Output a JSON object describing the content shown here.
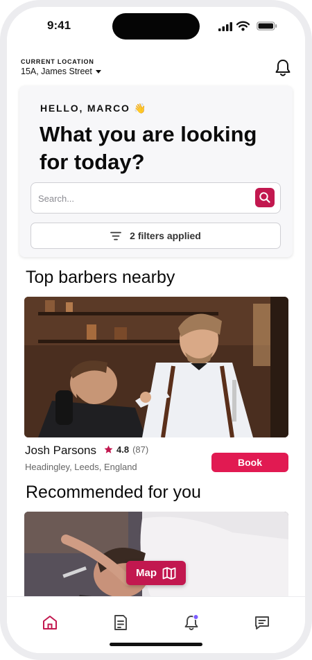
{
  "status_bar": {
    "time": "9:41"
  },
  "header": {
    "location_label": "CURRENT LOCATION",
    "location_value": "15A, James Street",
    "notification_icon": "bell-icon"
  },
  "hero": {
    "greeting": "HELLO, MARCO 👋",
    "title": "What you are looking for today?",
    "search": {
      "placeholder": "Search...",
      "value": ""
    },
    "filters_label": "2 filters applied"
  },
  "top_barbers": {
    "title": "Top barbers nearby",
    "card": {
      "name": "Josh Parsons",
      "rating": "4.8",
      "reviews": "(87)",
      "address": "Headingley, Leeds, England",
      "book_label": "Book"
    }
  },
  "recommended": {
    "title": "Recommended for you",
    "map_label": "Map"
  },
  "tab_bar": {
    "items": [
      "home-icon",
      "document-icon",
      "bell-icon",
      "chat-icon"
    ],
    "active_index": 0
  },
  "colors": {
    "accent": "#c2184f",
    "book": "#e11a52",
    "notification_dot": "#7b5cff"
  }
}
